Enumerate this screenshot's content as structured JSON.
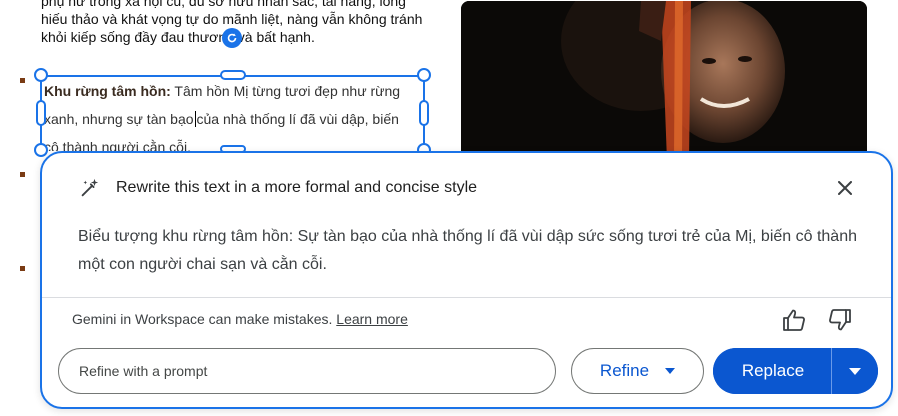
{
  "document": {
    "top_lines": [
      "phụ nữ trong xã hội cũ; dù sở hữu nhan sắc, tài năng, lòng",
      "hiếu thảo và khát vọng tự do mãnh liệt, nàng vẫn không tránh",
      "khỏi kiếp sống đầy đau thương và bất hạnh."
    ],
    "selected_box": {
      "bold_label": "Khu rừng tâm hồn:",
      "line1_rest": " Tâm hồn Mị từng tươi đẹp như rừng",
      "line2_before_caret": "xanh, nhưng sự tàn bạo",
      "line2_after_caret": "của nhà thống lí đã vùi dập, biến",
      "line3": "cô thành người cằn cỗi."
    },
    "bullet_color": "#7a3b14"
  },
  "panel": {
    "title": "Rewrite this text in a more formal and concise style",
    "result_text": "Biểu tượng khu rừng tâm hồn: Sự tàn bạo của nhà thống lí đã vùi dập sức sống tươi trẻ của Mị, biến cô thành một con người chai sạn và cằn cỗi.",
    "disclaimer": "Gemini in Workspace can make mistakes.",
    "learn_more": "Learn more",
    "prompt_placeholder": "Refine with a prompt",
    "refine_label": "Refine",
    "replace_label": "Replace",
    "icons": [
      "sparkle-pen-icon",
      "close-icon",
      "thumbs-up-icon",
      "thumbs-down-icon",
      "chevron-down-icon"
    ],
    "accent_color": "#0b57d0",
    "selection_color": "#1a73e8"
  }
}
